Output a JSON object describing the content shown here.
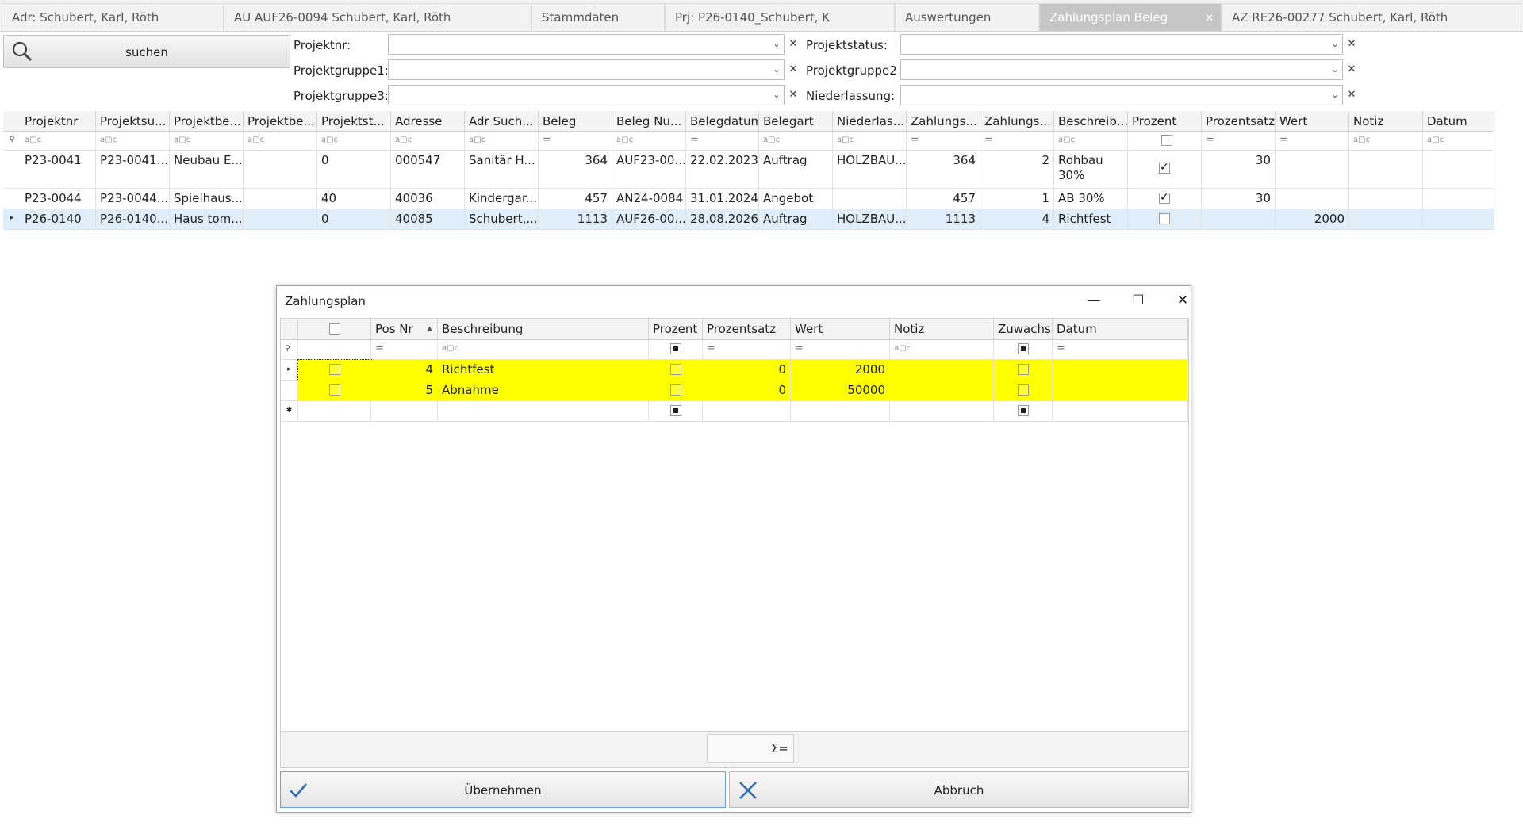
{
  "tabs": [
    {
      "label": "Adr: Schubert, Karl, Röth"
    },
    {
      "label": "AU AUF26-0094 Schubert, Karl, Röth"
    },
    {
      "label": "Stammdaten"
    },
    {
      "label": "Prj: P26-0140_Schubert, K"
    },
    {
      "label": "Auswertungen"
    },
    {
      "label": "Zahlungsplan Beleg",
      "close": "×"
    },
    {
      "label": "AZ RE26-00277 Schubert, Karl, Röth"
    }
  ],
  "search": {
    "button_label": "suchen",
    "filters": [
      {
        "label": "Projektnr:",
        "value": ""
      },
      {
        "label": "Projektgruppe1:",
        "value": ""
      },
      {
        "label": "Projektgruppe3:",
        "value": ""
      },
      {
        "label": "Projektstatus:",
        "value": ""
      },
      {
        "label": "Projektgruppe2",
        "value": ""
      },
      {
        "label": "Niederlassung:",
        "value": ""
      }
    ]
  },
  "grid": {
    "columns": [
      "Projektnr",
      "Projektsu...",
      "Projektbe...",
      "Projektbe...",
      "Projektst...",
      "Adresse",
      "Adr Such...",
      "Beleg",
      "Beleg Nu...",
      "Belegdatum",
      "Belegart",
      "Niederlas...",
      "Zahlungs...",
      "Zahlungs...",
      "Beschreib...",
      "Prozent",
      "Prozentsatz",
      "Wert",
      "Notiz",
      "Datum"
    ],
    "rows": [
      {
        "c": [
          "P23-0041",
          "P23-0041...",
          "Neubau E...",
          "",
          "0",
          "000547",
          "Sanitär H...",
          "364",
          "AUF23-00...",
          "22.02.2023",
          "Auftrag",
          "HOLZBAU...",
          "364",
          "2",
          "Rohbau 30%",
          "",
          "30",
          "",
          "",
          ""
        ],
        "prozent": true
      },
      {
        "c": [
          "P23-0044",
          "P23-0044...",
          "Spielhaus...",
          "",
          "40",
          "40036",
          "Kindergar...",
          "457",
          "AN24-0084",
          "31.01.2024",
          "Angebot",
          "",
          "457",
          "1",
          "AB 30%",
          "",
          "30",
          "",
          "",
          ""
        ],
        "prozent": true
      },
      {
        "c": [
          "P26-0140",
          "P26-0140...",
          "Haus tom...",
          "",
          "0",
          "40085",
          "Schubert,...",
          "1113",
          "AUF26-00...",
          "28.08.2026",
          "Auftrag",
          "HOLZBAU...",
          "1113",
          "4",
          "Richtfest",
          "",
          "",
          "2000",
          "",
          ""
        ],
        "prozent": false
      }
    ]
  },
  "dialog": {
    "title": "Zahlungsplan",
    "columns": [
      "",
      "Pos Nr",
      "Beschreibung",
      "Prozent",
      "Prozentsatz",
      "Wert",
      "Notiz",
      "Zuwachs",
      "Datum"
    ],
    "rows": [
      {
        "pos": "4",
        "beschreibung": "Richtfest",
        "prozentsatz": "0",
        "wert": "2000",
        "notiz": "",
        "datum": ""
      },
      {
        "pos": "5",
        "beschreibung": "Abnahme",
        "prozentsatz": "0",
        "wert": "50000",
        "notiz": "",
        "datum": ""
      }
    ],
    "sum_label": "Σ=",
    "ok_label": "Übernehmen",
    "cancel_label": "Abbruch",
    "highlight_color": "#ffff00"
  }
}
